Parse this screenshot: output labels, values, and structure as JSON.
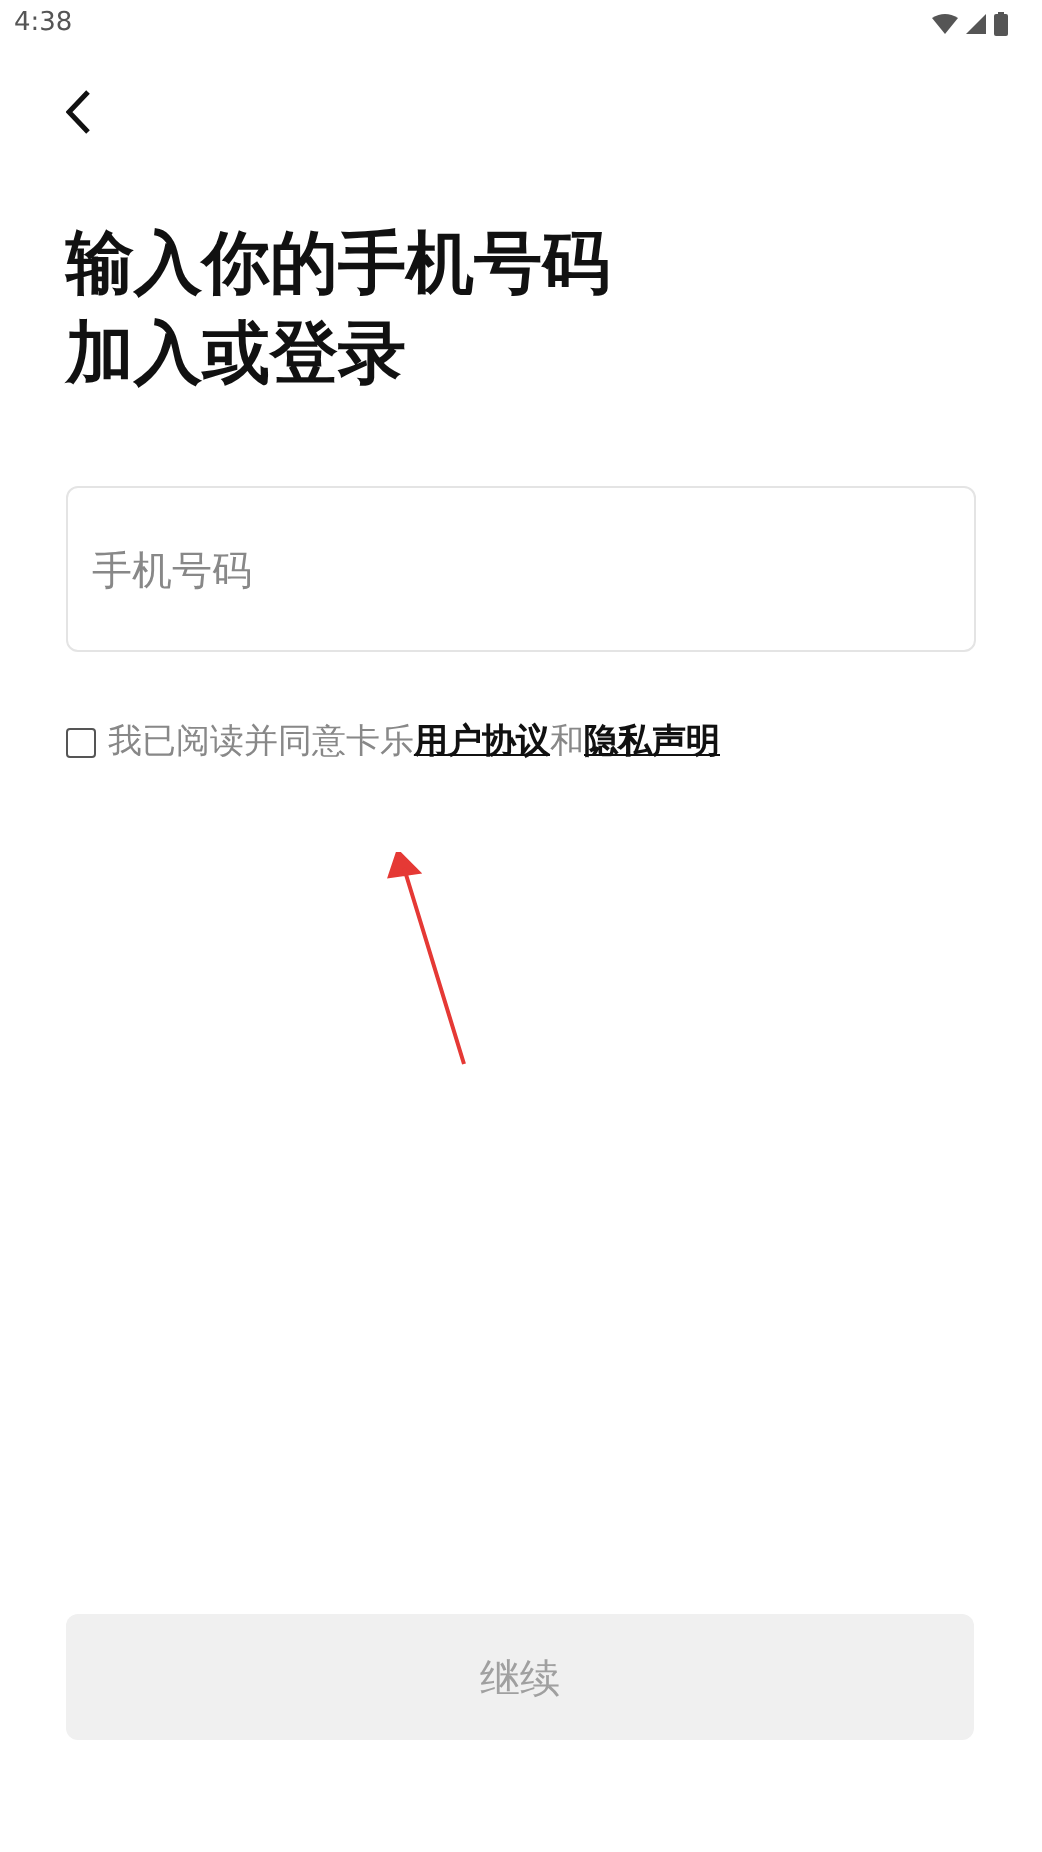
{
  "status_bar": {
    "time": "4:38"
  },
  "title_lines": [
    "输入你的手机号码",
    "加入或登录"
  ],
  "phone_field": {
    "placeholder": "手机号码"
  },
  "agreement": {
    "checked": false,
    "parts": [
      {
        "kind": "text",
        "text": "我已阅读并同意卡乐"
      },
      {
        "kind": "link",
        "text": "用户协议"
      },
      {
        "kind": "text",
        "text": "和"
      },
      {
        "kind": "link",
        "text": "隐私声明"
      }
    ]
  },
  "continue_button": {
    "label": "继续",
    "disabled": true
  }
}
